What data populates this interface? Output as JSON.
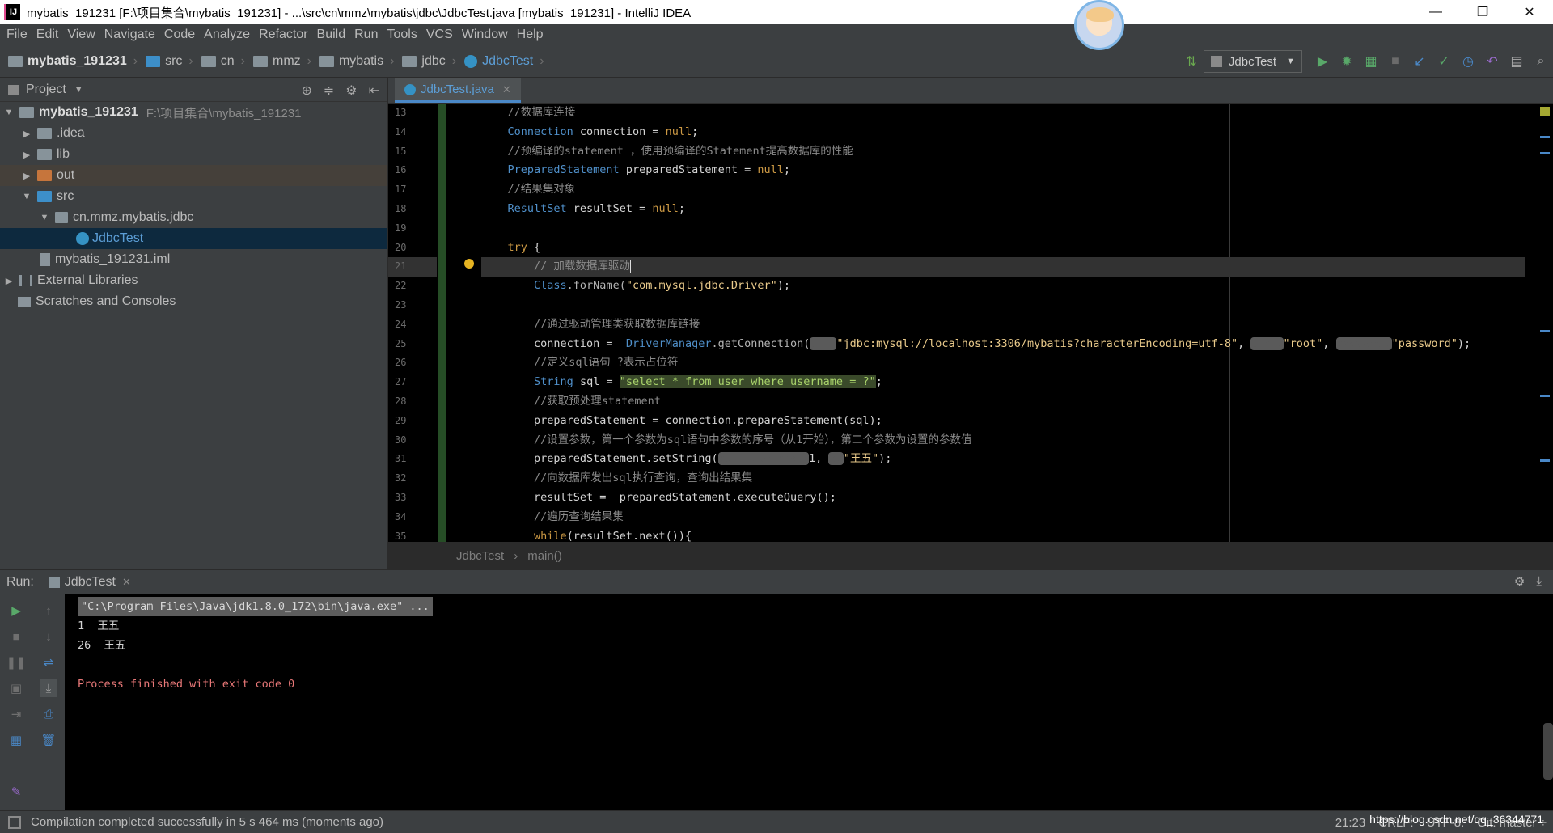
{
  "window": {
    "title": "mybatis_191231 [F:\\项目集合\\mybatis_191231] - ...\\src\\cn\\mmz\\mybatis\\jdbc\\JdbcTest.java [mybatis_191231] - IntelliJ IDEA",
    "app_icon": "IJ",
    "minimize": "—",
    "restore": "❐",
    "close": "✕"
  },
  "menu": [
    "File",
    "Edit",
    "View",
    "Navigate",
    "Code",
    "Analyze",
    "Refactor",
    "Build",
    "Run",
    "Tools",
    "VCS",
    "Window",
    "Help"
  ],
  "breadcrumbs": [
    "mybatis_191231",
    "src",
    "cn",
    "mmz",
    "mybatis",
    "jdbc",
    "JdbcTest"
  ],
  "run_config": "JdbcTest",
  "project_panel": {
    "title": "Project",
    "tree": [
      {
        "label": "mybatis_191231",
        "path": "F:\\项目集合\\mybatis_191231"
      },
      {
        "label": ".idea"
      },
      {
        "label": "lib"
      },
      {
        "label": "out"
      },
      {
        "label": "src"
      },
      {
        "label": "cn.mmz.mybatis.jdbc"
      },
      {
        "label": "JdbcTest"
      },
      {
        "label": "mybatis_191231.iml"
      },
      {
        "label": "External Libraries"
      },
      {
        "label": "Scratches and Consoles"
      }
    ]
  },
  "editor": {
    "tab": "JdbcTest.java",
    "line_numbers": [
      "13",
      "14",
      "15",
      "16",
      "17",
      "18",
      "19",
      "20",
      "21",
      "22",
      "23",
      "24",
      "25",
      "26",
      "27",
      "28",
      "29",
      "30",
      "31",
      "32",
      "33",
      "34",
      "35"
    ],
    "lines": {
      "l13": "//数据库连接",
      "l14a": "Connection",
      "l14b": " connection = ",
      "l14c": "null",
      "l14d": ";",
      "l15": "//预编译的statement ，使用预编译的Statement提高数据库的性能",
      "l16a": "PreparedStatement",
      "l16b": " preparedStatement = ",
      "l16c": "null",
      "l16d": ";",
      "l17": "//结果集对象",
      "l18a": "ResultSet",
      "l18b": " resultSet = ",
      "l18c": "null",
      "l18d": ";",
      "l20a": "try",
      "l20b": " {",
      "l21": "// 加载数据库驱动",
      "l22a": "Class",
      "l22b": ".forName(",
      "l22c": "\"com.mysql.jdbc.Driver\"",
      "l22d": ");",
      "l24": "//通过驱动管理类获取数据库链接",
      "l25a": "connection =  ",
      "l25b": "DriverManager",
      "l25c": ".getConnection(",
      "l25d": "\"jdbc:mysql://localhost:3306/mybatis?characterEncoding=utf-8\"",
      "l25e": ", ",
      "l25f": "\"root\"",
      "l25g": ", ",
      "l25h": "\"password\"",
      "l25i": ");",
      "l26": "//定义sql语句 ?表示占位符",
      "l27a": "String",
      "l27b": " sql = ",
      "l27c": "\"select * from user where username = ?\"",
      "l27d": ";",
      "l28": "//获取预处理statement",
      "l29": "preparedStatement = connection.prepareStatement(sql);",
      "l30": "//设置参数，第一个参数为sql语句中参数的序号（从1开始），第二个参数为设置的参数值",
      "l31a": "preparedStatement.setString(",
      "l31b": "1, ",
      "l31c": "\"王五\"",
      "l31d": ");",
      "l32": "//向数据库发出sql执行查询，查询出结果集",
      "l33": "resultSet =  preparedStatement.executeQuery();",
      "l34": "//遍历查询结果集",
      "l35a": "while",
      "l35b": "(resultSet.next()){"
    },
    "footer": [
      "JdbcTest",
      "main()"
    ]
  },
  "run_panel": {
    "label": "Run:",
    "tab": "JdbcTest",
    "console": {
      "cmd": "\"C:\\Program Files\\Java\\jdk1.8.0_172\\bin\\java.exe\" ...",
      "out1": "1  王五",
      "out2": "26  王五",
      "exit": "Process finished with exit code 0"
    }
  },
  "status": {
    "message": "Compilation completed successfully in 5 s 464 ms (moments ago)",
    "position": "21:23",
    "line_sep": "CRLF:",
    "encoding": "UTF-8:",
    "git": "Git: master ÷",
    "watermark": "https://blog.csdn.net/qq_36344771"
  }
}
